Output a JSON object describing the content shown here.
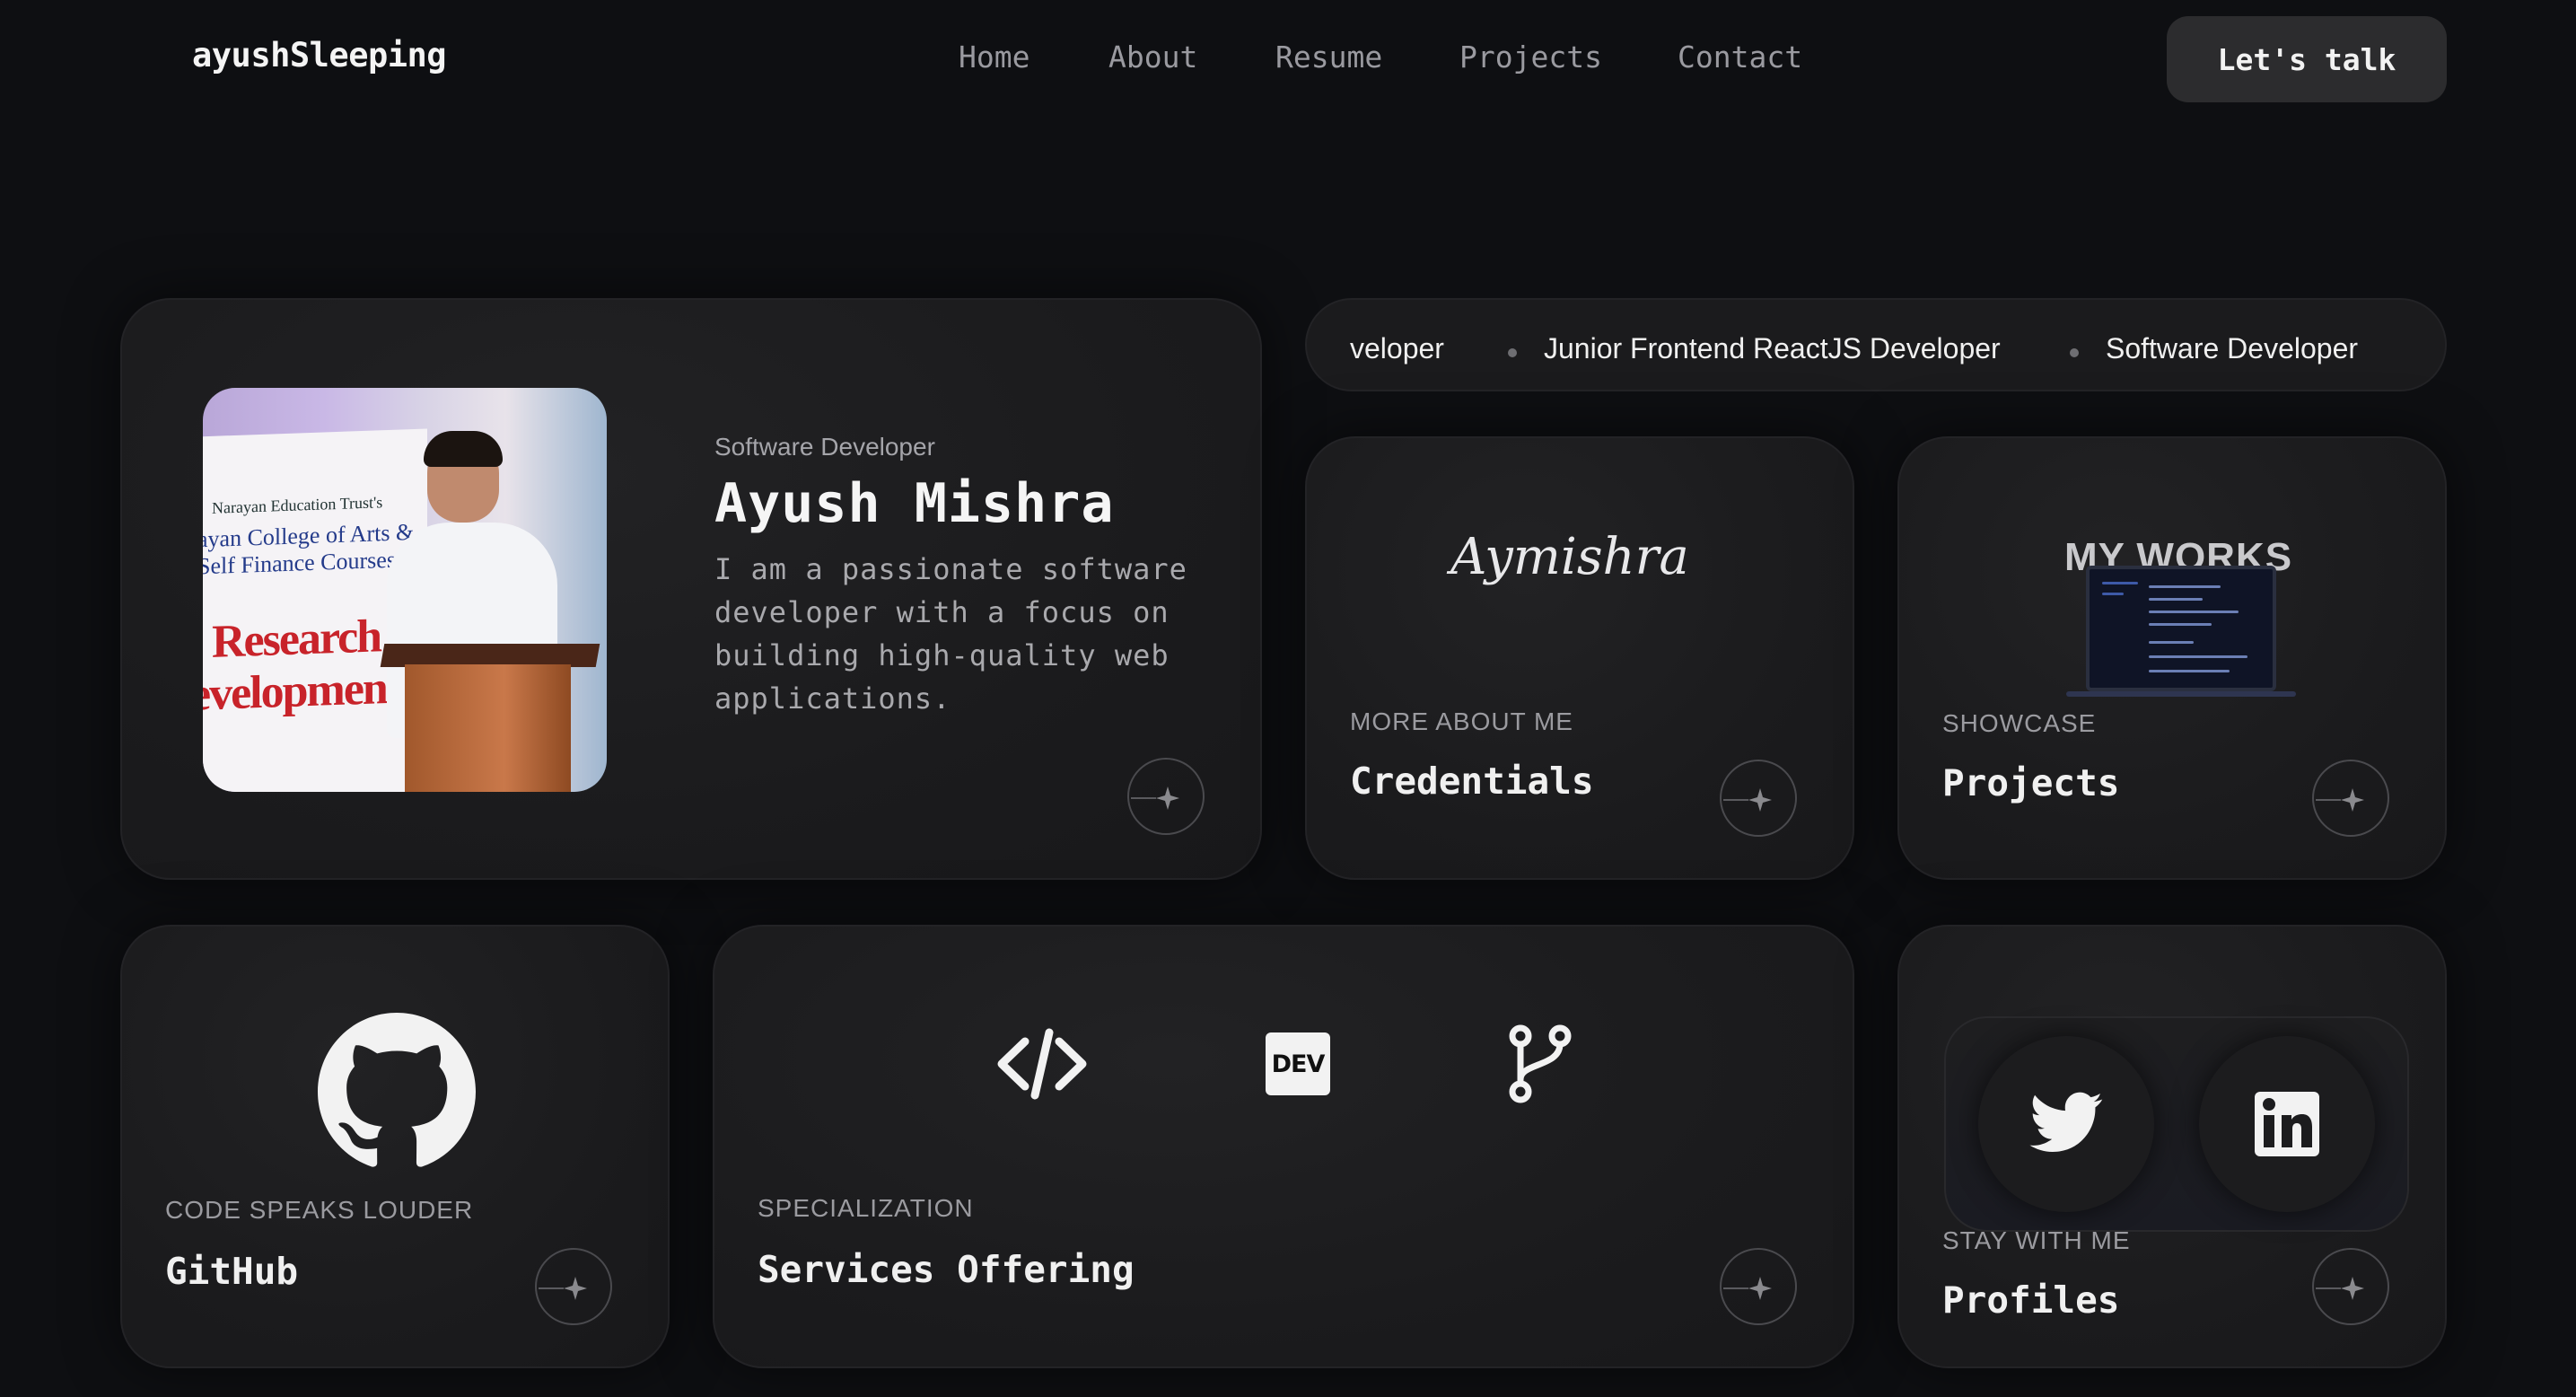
{
  "nav": {
    "brand": "ayushSleeping",
    "links": [
      "Home",
      "About",
      "Resume",
      "Projects",
      "Contact"
    ],
    "cta": "Let's talk"
  },
  "hero": {
    "role": "Software Developer",
    "name": "Ayush Mishra",
    "bio": "I am a passionate software developer with a focus on building high-quality web applications.",
    "photo_banner": {
      "line1": "Narayan Education Trust's",
      "line2": "ayan College of Arts &",
      "line3": "Self Finance Courses",
      "line4": "Research",
      "line5": "evelopmen"
    }
  },
  "marquee": {
    "items": [
      "veloper",
      "Junior Frontend ReactJS Developer",
      "Software Developer"
    ]
  },
  "credentials": {
    "signature": "Aymishra",
    "eyebrow": "MORE ABOUT ME",
    "title": "Credentials"
  },
  "projects": {
    "image_title": "MY WORKS",
    "eyebrow": "SHOWCASE",
    "title": "Projects"
  },
  "github": {
    "eyebrow": "CODE SPEAKS LOUDER",
    "title": "GitHub",
    "icon": "github-icon"
  },
  "services": {
    "eyebrow": "SPECIALIZATION",
    "title": "Services Offering",
    "icons": [
      "code-icon",
      "dev-icon",
      "git-branch-icon"
    ],
    "dev_badge": "DEV"
  },
  "profiles": {
    "eyebrow": "STAY WITH ME",
    "title": "Profiles",
    "icons": [
      "twitter-icon",
      "linkedin-icon"
    ]
  },
  "colors": {
    "background": "#0e0f12",
    "card": "#1b1b1d",
    "text": "#f0f0f0",
    "muted": "#9b9ba0"
  }
}
